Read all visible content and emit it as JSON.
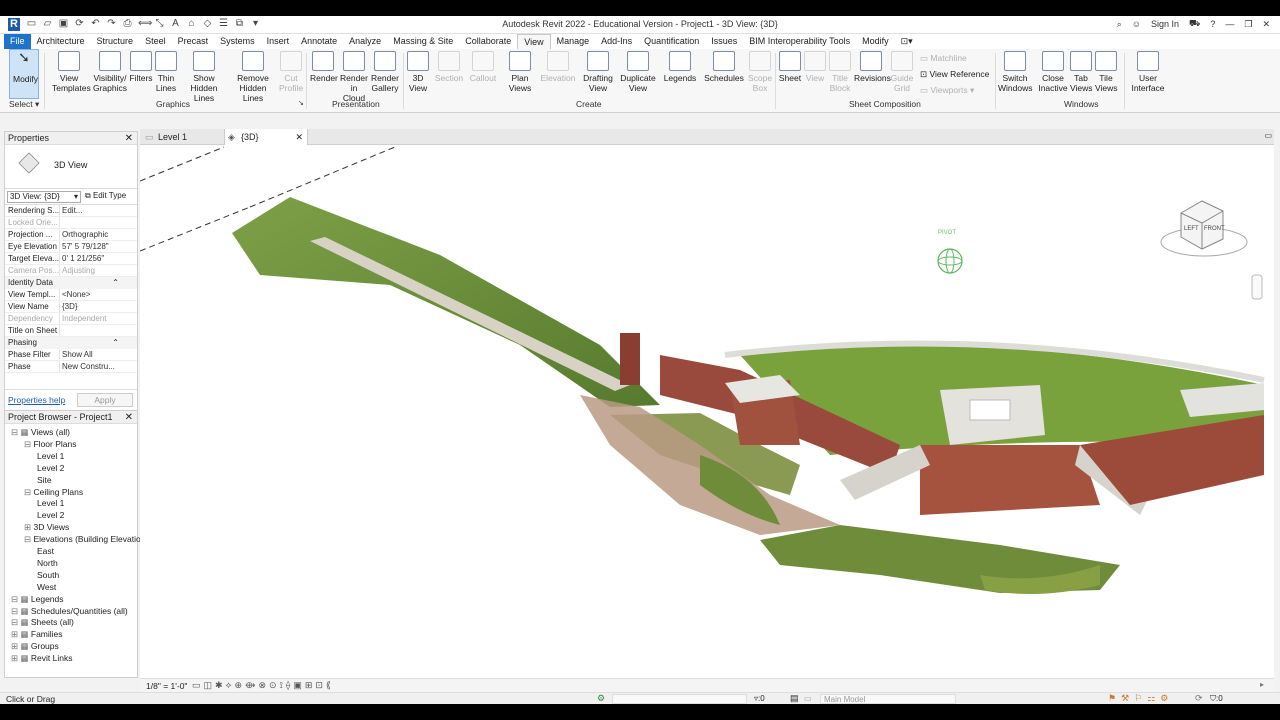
{
  "app": {
    "title": "Autodesk Revit 2022 - Educational Version - Project1 - 3D View: {3D}",
    "sign_in": "Sign In"
  },
  "tabs": [
    "File",
    "Architecture",
    "Structure",
    "Steel",
    "Precast",
    "Systems",
    "Insert",
    "Annotate",
    "Analyze",
    "Massing & Site",
    "Collaborate",
    "View",
    "Manage",
    "Add-Ins",
    "Quantification",
    "Issues",
    "BIM Interoperability Tools",
    "Modify"
  ],
  "active_tab": "View",
  "ribbon": {
    "modify": "Modify",
    "select": "Select",
    "graphics": {
      "panel": "Graphics",
      "view_templates": [
        "View",
        "Templates"
      ],
      "visibility_graphics": [
        "Visibility/",
        "Graphics"
      ],
      "filters": "Filters",
      "thin_lines": [
        "Thin",
        "Lines"
      ],
      "show_hidden": [
        "Show",
        "Hidden Lines"
      ],
      "remove_hidden": [
        "Remove",
        "Hidden Lines"
      ],
      "cut_profile": [
        "Cut",
        "Profile"
      ]
    },
    "presentation": {
      "panel": "Presentation",
      "render": "Render",
      "render_cloud": [
        "Render",
        "in Cloud"
      ],
      "render_gallery": [
        "Render",
        "Gallery"
      ]
    },
    "create": {
      "panel": "Create",
      "view3d": [
        "3D",
        "View"
      ],
      "section": "Section",
      "callout": "Callout",
      "plan_views": [
        "Plan",
        "Views"
      ],
      "elevation": "Elevation",
      "drafting_view": [
        "Drafting",
        "View"
      ],
      "duplicate_view": [
        "Duplicate",
        "View"
      ],
      "legends": "Legends",
      "schedules": "Schedules",
      "scope_box": [
        "Scope",
        "Box"
      ]
    },
    "sheet_composition": {
      "panel": "Sheet Composition",
      "sheet": "Sheet",
      "view": "View",
      "title_block": [
        "Title",
        "Block"
      ],
      "revisions": "Revisions",
      "guide_grid": [
        "Guide",
        "Grid"
      ],
      "matchline": "Matchline",
      "view_reference": "View Reference",
      "viewports": "Viewports"
    },
    "windows": {
      "panel": "Windows",
      "switch_windows": [
        "Switch",
        "Windows"
      ],
      "close_inactive": [
        "Close",
        "Inactive"
      ],
      "tab_views": [
        "Tab",
        "Views"
      ],
      "tile_views": [
        "Tile",
        "Views"
      ]
    },
    "user_interface": [
      "User",
      "Interface"
    ]
  },
  "view_tabs": [
    "Level 1",
    "{3D}"
  ],
  "properties": {
    "title": "Properties",
    "type_name": "3D View",
    "selector": "3D View: {3D}",
    "edit_type": "Edit Type",
    "rows": [
      {
        "k": "Rendering S...",
        "v": "Edit...",
        "dim": false
      },
      {
        "k": "Locked Orie...",
        "v": "",
        "dim": true
      },
      {
        "k": "Projection ...",
        "v": "Orthographic",
        "dim": false
      },
      {
        "k": "Eye Elevation",
        "v": "57' 5 79/128\"",
        "dim": false
      },
      {
        "k": "Target Eleva...",
        "v": "0' 1 21/256\"",
        "dim": false
      },
      {
        "k": "Camera Pos...",
        "v": "Adjusting",
        "dim": true
      }
    ],
    "identity_group": "Identity Data",
    "identity_rows": [
      {
        "k": "View Templ...",
        "v": "<None>",
        "dim": false
      },
      {
        "k": "View Name",
        "v": "{3D}",
        "dim": false
      },
      {
        "k": "Dependency",
        "v": "Independent",
        "dim": true
      },
      {
        "k": "Title on Sheet",
        "v": "",
        "dim": false
      }
    ],
    "phasing_group": "Phasing",
    "phasing_rows": [
      {
        "k": "Phase Filter",
        "v": "Show All",
        "dim": false
      },
      {
        "k": "Phase",
        "v": "New Constru...",
        "dim": false
      }
    ],
    "help": "Properties help",
    "apply": "Apply"
  },
  "browser": {
    "title": "Project Browser - Project1",
    "nodes": [
      "Views (all)",
      "Floor Plans",
      "Level 1",
      "Level 2",
      "Site",
      "Ceiling Plans",
      "Level 1",
      "Level 2",
      "3D Views",
      "Elevations (Building Elevation)",
      "East",
      "North",
      "South",
      "West",
      "Legends",
      "Schedules/Quantities (all)",
      "Sheets (all)",
      "Families",
      "Groups",
      "Revit Links"
    ]
  },
  "canvas": {
    "pivot": "PIVOT",
    "cube_left": "LEFT",
    "cube_front": "FRONT"
  },
  "view_control": {
    "scale": "1/8\" = 1'-0\""
  },
  "status": {
    "hint": "Click or Drag",
    "zero": ":0",
    "main_model": "Main Model",
    "filter_count": ":0"
  }
}
